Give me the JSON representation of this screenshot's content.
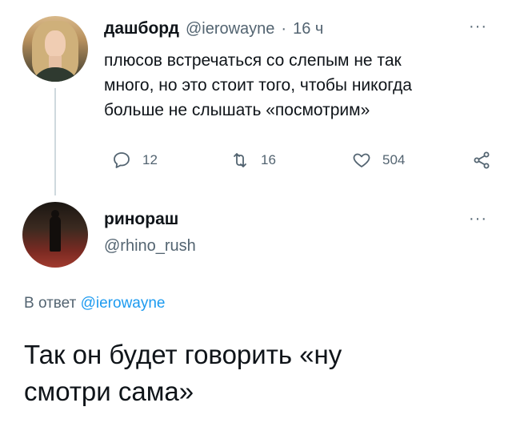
{
  "tweet1": {
    "display_name": "дашборд",
    "handle": "@ierowayne",
    "separator": "·",
    "time": "16 ч",
    "more": "···",
    "text_lines": [
      "плюсов встречаться со слепым не так",
      "много, но это стоит того, чтобы никогда",
      "больше не слышать «посмотрим»"
    ],
    "actions": {
      "replies": "12",
      "retweets": "16",
      "likes": "504"
    }
  },
  "tweet2": {
    "display_name": "ринораш",
    "handle": "@rhino_rush",
    "more": "···",
    "reply_prefix": "В ответ",
    "reply_handle": "@ierowayne",
    "text_lines": [
      "Так он будет говорить «ну",
      "смотри сама»"
    ]
  },
  "icons": {
    "reply": "reply-icon",
    "retweet": "retweet-icon",
    "like": "heart-icon",
    "share": "share-icon"
  },
  "colors": {
    "text": "#0f1419",
    "muted": "#536471",
    "link": "#1d9bf0",
    "thread_line": "#cfd9de"
  }
}
